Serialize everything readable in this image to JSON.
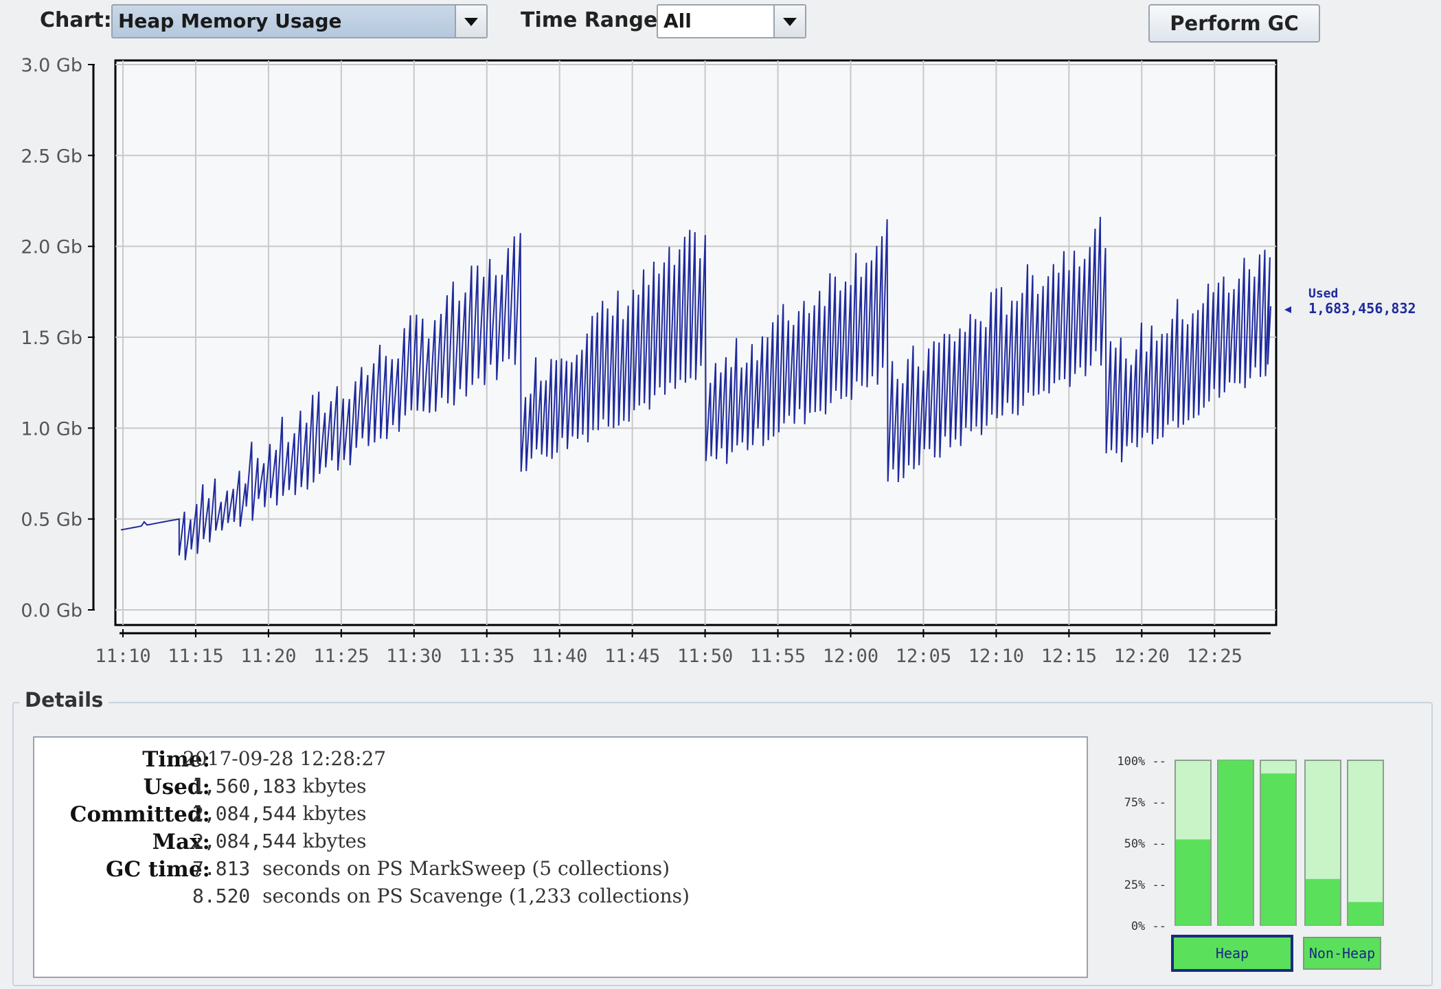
{
  "toolbar": {
    "chart_label": "Chart:",
    "chart_selected": "Heap Memory Usage",
    "time_range_label": "Time Range:",
    "time_range_selected": "All",
    "perform_gc_label": "Perform GC"
  },
  "chart_data": {
    "type": "line",
    "y_ticks": [
      "3.0 Gb",
      "2.5 Gb",
      "2.0 Gb",
      "1.5 Gb",
      "1.0 Gb",
      "0.5 Gb",
      "0.0 Gb"
    ],
    "x_ticks": [
      "11:10",
      "11:15",
      "11:20",
      "11:25",
      "11:30",
      "11:35",
      "11:40",
      "11:45",
      "11:50",
      "11:55",
      "12:00",
      "12:05",
      "12:10",
      "12:15",
      "12:20",
      "12:25"
    ],
    "ylim_gb": [
      0,
      3.0
    ],
    "grid": true,
    "series": [
      {
        "name": "Used",
        "color": "#1f2a9c",
        "last_value_label": "1,683,456,832",
        "envelope_segments_minutes": [
          {
            "start": 0,
            "end": 4,
            "min": [
              0.44,
              0.5
            ],
            "max": [
              0.44,
              0.5
            ],
            "flat": true
          },
          {
            "start": 4,
            "end": 27.5,
            "min": [
              0.3,
              1.4
            ],
            "max": [
              0.5,
              2.0
            ]
          },
          {
            "start": 27.5,
            "end": 40.2,
            "min": [
              0.8,
              1.3
            ],
            "max": [
              1.25,
              2.05
            ]
          },
          {
            "start": 40.2,
            "end": 52.7,
            "min": [
              0.8,
              1.3
            ],
            "max": [
              1.25,
              2.05
            ]
          },
          {
            "start": 52.7,
            "end": 67.7,
            "min": [
              0.72,
              1.4
            ],
            "max": [
              1.25,
              2.1
            ]
          },
          {
            "start": 67.7,
            "end": 79,
            "min": [
              0.82,
              1.35
            ],
            "max": [
              1.35,
              1.95
            ]
          }
        ]
      }
    ]
  },
  "details": {
    "title": "Details",
    "time_label": "Time:",
    "time_value": "2017-09-28 12:28:27",
    "used_label": "Used:",
    "used_value": "1,560,183",
    "used_unit": "kbytes",
    "committed_label": "Committed:",
    "committed_value": "2,084,544",
    "committed_unit": "kbytes",
    "max_label": "Max:",
    "max_value": "2,084,544",
    "max_unit": "kbytes",
    "gc_label": "GC time:",
    "gc1_value": "7.813",
    "gc1_text": "seconds on PS MarkSweep (5 collections)",
    "gc2_value": "8.520",
    "gc2_text": "seconds on PS Scavenge (1,233 collections)"
  },
  "memory_bars": {
    "y_ticks": [
      "100% --",
      "75% --",
      "50% --",
      "25% --",
      "0% --"
    ],
    "heap_label": "Heap",
    "non_heap_label": "Non-Heap",
    "heap_fractions": [
      0.52,
      1.0,
      0.92
    ],
    "non_heap_fractions": [
      0.28,
      0.14
    ],
    "fill_color": "#5be05b",
    "empty_color": "#c8f4c8"
  }
}
